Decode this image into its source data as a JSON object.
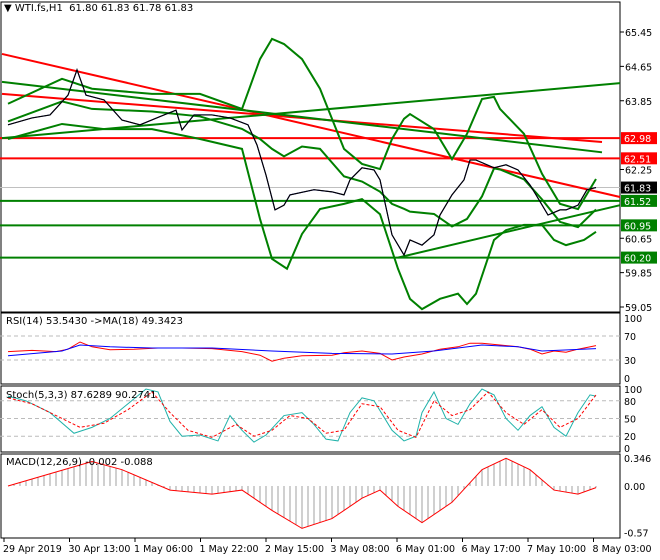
{
  "header": {
    "symbol": "WTI.fs,H1",
    "ohlc": "61.80 61.83 61.78 61.83"
  },
  "indicators": {
    "rsi": "RSI(14) 53.5430  ->MA(18) 49.3423",
    "stoch": "Stoch(5,3,3) 87.6289 90.2741",
    "macd": "MACD(12,26,9) -0.002 -0.088"
  },
  "colors": {
    "price": "#000000",
    "bands": "#008000",
    "resistance": "#ff0000",
    "support": "#008000",
    "rsi": "#ff0000",
    "rsi_ma": "#0000ff",
    "stoch_main": "#20b2aa",
    "stoch_signal": "#ff0000",
    "macd": "#ff0000",
    "hist": "#a0a0a0"
  },
  "chart_data": {
    "type": "line",
    "title": "WTI.fs,H1",
    "price_axis": {
      "min": 59.05,
      "max": 65.45,
      "ticks": [
        "65.45",
        "64.65",
        "63.85",
        "62.25",
        "60.65",
        "59.85",
        "59.05"
      ]
    },
    "x_ticks": [
      "29 Apr 2019",
      "30 Apr 13:00",
      "1 May 06:00",
      "1 May 22:00",
      "2 May 15:00",
      "3 May 08:00",
      "6 May 01:00",
      "6 May 17:00",
      "7 May 10:00",
      "8 May 03:00"
    ],
    "levels": [
      {
        "value": "62.98",
        "color": "#ff0000"
      },
      {
        "value": "62.51",
        "color": "#ff0000"
      },
      {
        "value": "61.83",
        "color": "#000000",
        "current": true
      },
      {
        "value": "61.52",
        "color": "#008000"
      },
      {
        "value": "60.95",
        "color": "#008000"
      },
      {
        "value": "60.20",
        "color": "#008000"
      }
    ],
    "price": [
      [
        1,
        63.29
      ],
      [
        5,
        63.45
      ],
      [
        8,
        63.52
      ],
      [
        11,
        63.98
      ],
      [
        12.5,
        64.57
      ],
      [
        14,
        63.98
      ],
      [
        17,
        63.87
      ],
      [
        20,
        63.4
      ],
      [
        23,
        63.29
      ],
      [
        27,
        63.52
      ],
      [
        29,
        63.63
      ],
      [
        30,
        63.17
      ],
      [
        32,
        63.52
      ],
      [
        35,
        63.52
      ],
      [
        38,
        63.45
      ],
      [
        41,
        63.29
      ],
      [
        42.5,
        62.82
      ],
      [
        44,
        62.12
      ],
      [
        45.5,
        61.31
      ],
      [
        47,
        61.42
      ],
      [
        48,
        61.66
      ],
      [
        52,
        61.78
      ],
      [
        55,
        61.73
      ],
      [
        57,
        61.66
      ],
      [
        58,
        62.01
      ],
      [
        60,
        62.29
      ],
      [
        62,
        62.24
      ],
      [
        63,
        62.01
      ],
      [
        65,
        60.73
      ],
      [
        67,
        60.26
      ],
      [
        68,
        60.61
      ],
      [
        70,
        60.49
      ],
      [
        72,
        60.73
      ],
      [
        73,
        61.19
      ],
      [
        75,
        61.66
      ],
      [
        77,
        62.01
      ],
      [
        78,
        62.47
      ],
      [
        79,
        62.47
      ],
      [
        82,
        62.29
      ],
      [
        84,
        62.36
      ],
      [
        86,
        62.24
      ],
      [
        88,
        61.89
      ],
      [
        89,
        61.66
      ],
      [
        91,
        61.19
      ],
      [
        93,
        61.31
      ],
      [
        94,
        61.31
      ],
      [
        96,
        61.42
      ],
      [
        97.5,
        61.78
      ],
      [
        99,
        61.83
      ]
    ],
    "bb_upper": [
      [
        1,
        63.78
      ],
      [
        10,
        64.36
      ],
      [
        15,
        64.13
      ],
      [
        25,
        64.01
      ],
      [
        33,
        64.01
      ],
      [
        40,
        63.66
      ],
      [
        43,
        64.82
      ],
      [
        45,
        65.29
      ],
      [
        47,
        65.17
      ],
      [
        50,
        64.82
      ],
      [
        53,
        64.13
      ],
      [
        57,
        62.73
      ],
      [
        60,
        62.38
      ],
      [
        63,
        62.26
      ],
      [
        65,
        62.96
      ],
      [
        67,
        63.43
      ],
      [
        68,
        63.54
      ],
      [
        72,
        63.19
      ],
      [
        75,
        62.49
      ],
      [
        77.5,
        63.08
      ],
      [
        80,
        63.89
      ],
      [
        82,
        63.94
      ],
      [
        83,
        63.66
      ],
      [
        87,
        63.08
      ],
      [
        90,
        62.15
      ],
      [
        93,
        61.45
      ],
      [
        96,
        61.33
      ],
      [
        99,
        62.03
      ]
    ],
    "bb_lower": [
      [
        1,
        62.96
      ],
      [
        10,
        63.31
      ],
      [
        17,
        63.19
      ],
      [
        25,
        63.19
      ],
      [
        33,
        62.96
      ],
      [
        40,
        62.73
      ],
      [
        43,
        61.1
      ],
      [
        45,
        60.17
      ],
      [
        47.5,
        59.94
      ],
      [
        50,
        60.75
      ],
      [
        53,
        61.33
      ],
      [
        57,
        61.45
      ],
      [
        60,
        61.56
      ],
      [
        63,
        61.21
      ],
      [
        66,
        59.94
      ],
      [
        68,
        59.24
      ],
      [
        70,
        59.0
      ],
      [
        73,
        59.24
      ],
      [
        76,
        59.36
      ],
      [
        77.5,
        59.12
      ],
      [
        79,
        59.36
      ],
      [
        82,
        60.61
      ],
      [
        84,
        60.84
      ],
      [
        87,
        60.96
      ],
      [
        90,
        60.96
      ],
      [
        92,
        60.61
      ],
      [
        94,
        60.49
      ],
      [
        97,
        60.61
      ],
      [
        99,
        60.8
      ]
    ],
    "trend_red": [
      [
        [
          0,
          64.94
        ],
        [
          103,
          61.61
        ]
      ],
      [
        [
          0,
          64.01
        ],
        [
          100,
          62.89
        ]
      ]
    ],
    "trend_green": [
      [
        [
          0,
          64.29
        ],
        [
          100,
          62.65
        ]
      ],
      [
        [
          0,
          62.98
        ],
        [
          103,
          64.26
        ]
      ],
      [
        [
          66,
          60.2
        ],
        [
          103,
          61.42
        ]
      ]
    ],
    "rsi": {
      "axis": [
        "100",
        "70",
        "30",
        "0"
      ],
      "values": [
        [
          1,
          44
        ],
        [
          5,
          46
        ],
        [
          9,
          44
        ],
        [
          11,
          48
        ],
        [
          13,
          60
        ],
        [
          15,
          52
        ],
        [
          18,
          47
        ],
        [
          22,
          48
        ],
        [
          26,
          50
        ],
        [
          30,
          50
        ],
        [
          35,
          49
        ],
        [
          40,
          44
        ],
        [
          43,
          38
        ],
        [
          45,
          28
        ],
        [
          47,
          33
        ],
        [
          50,
          37
        ],
        [
          55,
          38
        ],
        [
          57,
          42
        ],
        [
          60,
          45
        ],
        [
          63,
          41
        ],
        [
          65,
          30
        ],
        [
          67,
          35
        ],
        [
          70,
          40
        ],
        [
          73,
          48
        ],
        [
          76,
          52
        ],
        [
          78,
          58
        ],
        [
          80,
          58
        ],
        [
          83,
          55
        ],
        [
          86,
          52
        ],
        [
          88,
          48
        ],
        [
          90,
          40
        ],
        [
          92,
          45
        ],
        [
          94,
          43
        ],
        [
          96,
          48
        ],
        [
          99,
          54
        ]
      ],
      "ma": [
        [
          1,
          37
        ],
        [
          10,
          45
        ],
        [
          13,
          55
        ],
        [
          18,
          52
        ],
        [
          25,
          50
        ],
        [
          35,
          50
        ],
        [
          45,
          45
        ],
        [
          55,
          41
        ],
        [
          65,
          40
        ],
        [
          72,
          45
        ],
        [
          80,
          55
        ],
        [
          86,
          52
        ],
        [
          90,
          45
        ],
        [
          99,
          49
        ]
      ]
    },
    "stoch": {
      "axis": [
        "100",
        "80",
        "50",
        "20",
        "0"
      ],
      "main": [
        [
          1,
          88
        ],
        [
          4,
          80
        ],
        [
          8,
          60
        ],
        [
          12,
          25
        ],
        [
          15,
          35
        ],
        [
          18,
          50
        ],
        [
          21,
          75
        ],
        [
          24,
          100
        ],
        [
          26,
          95
        ],
        [
          28,
          45
        ],
        [
          30,
          20
        ],
        [
          33,
          22
        ],
        [
          36,
          12
        ],
        [
          38,
          55
        ],
        [
          40,
          30
        ],
        [
          42,
          10
        ],
        [
          44,
          22
        ],
        [
          47,
          55
        ],
        [
          50,
          60
        ],
        [
          52,
          40
        ],
        [
          54,
          15
        ],
        [
          56,
          12
        ],
        [
          58,
          60
        ],
        [
          60,
          85
        ],
        [
          62,
          80
        ],
        [
          65,
          30
        ],
        [
          67,
          12
        ],
        [
          69,
          20
        ],
        [
          70,
          60
        ],
        [
          72,
          95
        ],
        [
          74,
          50
        ],
        [
          76,
          40
        ],
        [
          78,
          75
        ],
        [
          80,
          100
        ],
        [
          82,
          90
        ],
        [
          84,
          50
        ],
        [
          86,
          30
        ],
        [
          88,
          55
        ],
        [
          90,
          70
        ],
        [
          92,
          35
        ],
        [
          94,
          20
        ],
        [
          96,
          60
        ],
        [
          98,
          90
        ],
        [
          99,
          88
        ]
      ],
      "signal": [
        [
          1,
          85
        ],
        [
          5,
          75
        ],
        [
          9,
          55
        ],
        [
          13,
          35
        ],
        [
          17,
          42
        ],
        [
          21,
          65
        ],
        [
          25,
          95
        ],
        [
          28,
          60
        ],
        [
          31,
          30
        ],
        [
          35,
          18
        ],
        [
          39,
          40
        ],
        [
          42,
          20
        ],
        [
          45,
          30
        ],
        [
          48,
          55
        ],
        [
          51,
          50
        ],
        [
          54,
          25
        ],
        [
          57,
          30
        ],
        [
          60,
          75
        ],
        [
          63,
          70
        ],
        [
          66,
          30
        ],
        [
          69,
          18
        ],
        [
          72,
          80
        ],
        [
          75,
          55
        ],
        [
          78,
          65
        ],
        [
          81,
          95
        ],
        [
          84,
          60
        ],
        [
          87,
          40
        ],
        [
          90,
          65
        ],
        [
          93,
          35
        ],
        [
          96,
          50
        ],
        [
          99,
          90
        ]
      ]
    },
    "macd": {
      "axis": [
        "0.346",
        "0.00",
        "-0.57"
      ],
      "values": [
        [
          1,
          0.0
        ],
        [
          8,
          0.15
        ],
        [
          15,
          0.3
        ],
        [
          20,
          0.2
        ],
        [
          28,
          -0.05
        ],
        [
          35,
          -0.1
        ],
        [
          40,
          -0.05
        ],
        [
          45,
          -0.3
        ],
        [
          50,
          -0.52
        ],
        [
          55,
          -0.4
        ],
        [
          60,
          -0.15
        ],
        [
          63,
          -0.05
        ],
        [
          66,
          -0.25
        ],
        [
          70,
          -0.45
        ],
        [
          75,
          -0.2
        ],
        [
          80,
          0.2
        ],
        [
          84,
          0.34
        ],
        [
          88,
          0.2
        ],
        [
          92,
          -0.05
        ],
        [
          96,
          -0.1
        ],
        [
          99,
          -0.02
        ]
      ]
    }
  }
}
